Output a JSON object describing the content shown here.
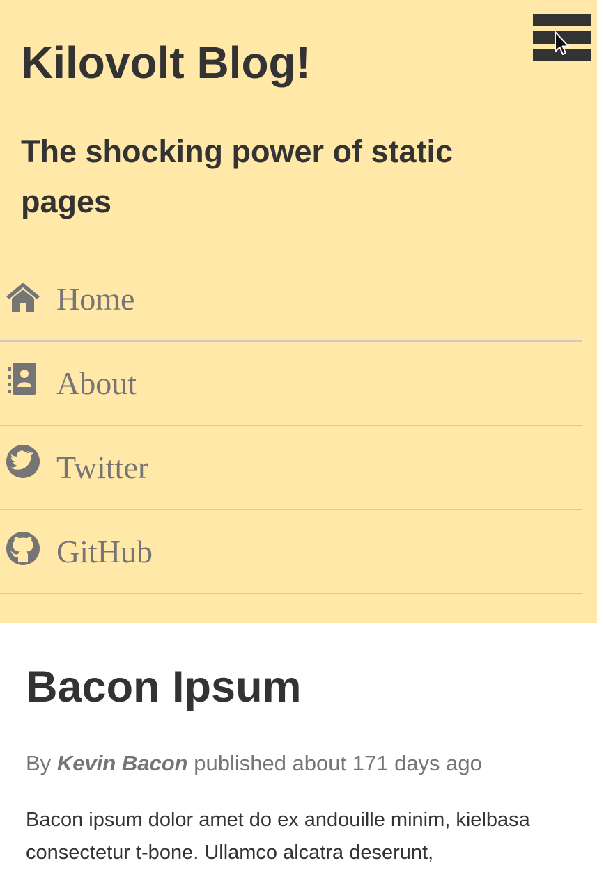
{
  "site": {
    "title": "Kilovolt Blog!",
    "tagline": "The shocking power of static pages"
  },
  "colors": {
    "header_background": "#ffe8a8",
    "text": "#333333",
    "muted": "#757575",
    "divider": "#cfcac0"
  },
  "menu_toggle": {
    "icon": "hamburger-menu-icon"
  },
  "nav": {
    "items": [
      {
        "label": "Home",
        "icon": "home-icon"
      },
      {
        "label": "About",
        "icon": "address-book-icon"
      },
      {
        "label": "Twitter",
        "icon": "twitter-icon"
      },
      {
        "label": "GitHub",
        "icon": "github-icon"
      }
    ]
  },
  "post": {
    "title": "Bacon Ipsum",
    "byline_prefix": "By",
    "author": "Kevin Bacon",
    "published": "published about 171 days ago",
    "body": "Bacon ipsum dolor amet do ex andouille minim, kielbasa consectetur t-bone. Ullamco alcatra deserunt,"
  }
}
